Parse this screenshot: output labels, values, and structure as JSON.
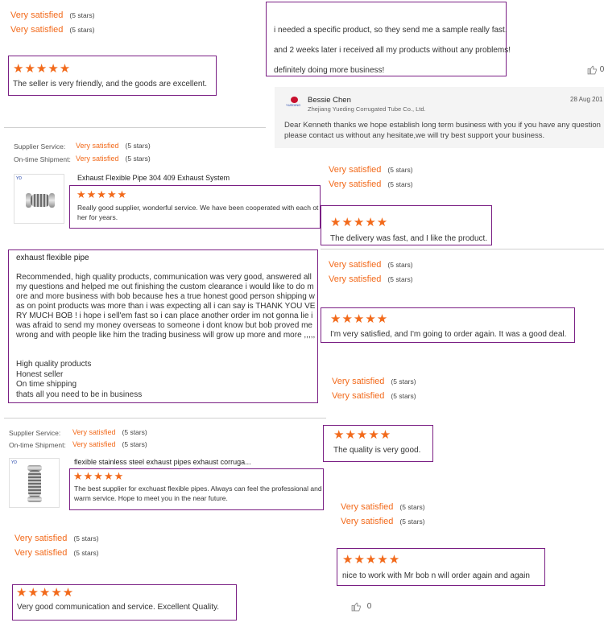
{
  "sat_label": "Very satisfied",
  "stars_label": "(5 stars)",
  "star_glyphs": "★★★★★",
  "colors": {
    "accent": "#f26a1b",
    "box_border": "#7a1f84"
  },
  "labels": {
    "supplier_service": "Supplier Service:",
    "on_time_shipment": "On-time Shipment:"
  },
  "reviews": {
    "r1": "The seller is very friendly, and the goods are excellent.",
    "r2_lines": [
      "i needed a specific product, so they send me a sample really fast.",
      "and 2 weeks later i received all my products without any problems!",
      "definitely doing more business!"
    ],
    "r3_product": "Exhaust Flexible Pipe 304 409 Exhaust System",
    "r3_text": "Really good supplier, wonderful service. We have been cooperated with each other for years.",
    "r4": "The delivery was fast, and I like the product.",
    "r5_title": "exhaust flexible pipe",
    "r5_body": "Recommended, high quality products, communication  was very good, answered all my questions and helped me out finishing the custom clearance i would like to do more and more business with bob because hes a true honest good person shipping was on point products was more than i was expecting all i can say is THANK YOU VERY MUCH BOB ! i hope i sell'em fast so i can place another order im not gonna lie i was afraid to send my money overseas to someone i dont know but bob proved me wrong and with people like him the trading business will grow up more and more  ,,,,,",
    "r5_list": [
      "High quality products",
      "Honest seller",
      "On time shipping",
      "thats all you need to be in business"
    ],
    "r6": "I'm very satisfied, and I'm going to order again. It was a good deal.",
    "r7": "The quality is very good.",
    "r8_product": "flexible stainless steel exhaust pipes exhaust corruga...",
    "r8_text": "The best supplier for exchuast flexible pipes. Always can feel the professional and warm service. Hope to meet you in the near future.",
    "r9": "nice to work with Mr bob n will order again and again",
    "r10": "Very good communication and service. Excellent Quality."
  },
  "reply": {
    "name": "Bessie Chen",
    "company": "Zhejiang Yueding Corrugated Tube Co., Ltd.",
    "date": "28 Aug 201",
    "logo_text": "YUEDING",
    "text": "Dear Kenneth thanks we hope establish long term business with you if you have any question please contact us without any hesitate,we will try best support your business."
  },
  "likes": {
    "top": "0",
    "bottom": "0"
  },
  "icons": [
    "thumbs-up-icon",
    "star-icon",
    "company-logo-icon",
    "product-image-icon"
  ]
}
